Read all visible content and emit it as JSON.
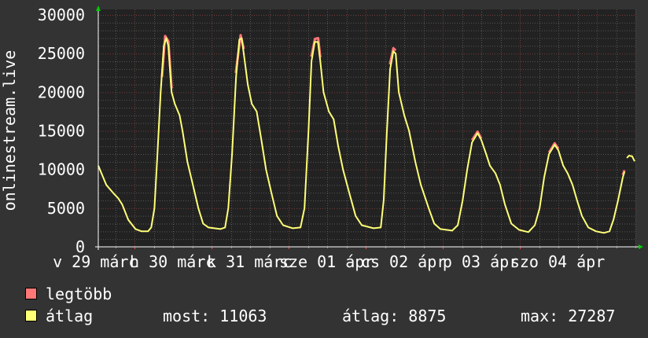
{
  "chart_data": {
    "type": "line",
    "title": "",
    "ylabel": "onlinestream.live",
    "xlabel": "",
    "ylim": [
      0,
      30000
    ],
    "xlim": [
      "03-28 12:40",
      "04-04 12:00"
    ],
    "yticks": [
      "0",
      "5000",
      "10000",
      "15000",
      "20000",
      "25000",
      "30000"
    ],
    "xticks": [
      {
        "at": "03-28 12:00",
        "label": "v 29 márc"
      },
      {
        "at": "03-29 12:00",
        "label": "h 30 márc"
      },
      {
        "at": "03-30 12:00",
        "label": "k 31 márc"
      },
      {
        "at": "03-31 12:00",
        "label": "sze 01 ápr"
      },
      {
        "at": "04-01 12:00",
        "label": "cs 02 ápr"
      },
      {
        "at": "04-02 12:00",
        "label": "p 03 ápr"
      },
      {
        "at": "04-03 12:00",
        "label": "szo 04 ápr"
      }
    ],
    "grid": true,
    "colors": {
      "background": "#333333",
      "plot": "#222222",
      "max": "#ff7777",
      "avg": "#ffff77",
      "major_grid": "#7a3a3a",
      "minor_grid": "#555555",
      "arrow": "#00cc00"
    },
    "series": [
      {
        "name": "legtöbb",
        "color": "#ff7777",
        "points": [
          [
            "03-29 08:30",
            22000
          ],
          [
            "03-29 09:30",
            27287
          ],
          [
            "03-29 10:30",
            26600
          ],
          [
            "03-29 11:30",
            20500
          ],
          null,
          [
            "03-30 07:30",
            22500
          ],
          [
            "03-30 09:00",
            27400
          ],
          [
            "03-30 10:00",
            25600
          ],
          null,
          [
            "03-31 07:00",
            24600
          ],
          [
            "03-31 08:10",
            26900
          ],
          [
            "03-31 09:10",
            27000
          ],
          [
            "03-31 09:50",
            24500
          ],
          null,
          [
            "04-01 07:30",
            23600
          ],
          [
            "04-01 08:35",
            25700
          ],
          [
            "04-01 09:20",
            25400
          ],
          null,
          [
            "04-02 09:05",
            13800
          ],
          [
            "04-02 10:50",
            14900
          ],
          [
            "04-02 12:00",
            14000
          ],
          null,
          [
            "04-03 09:05",
            12200
          ],
          [
            "04-03 10:50",
            13400
          ],
          [
            "04-03 12:00",
            12700
          ],
          null,
          [
            "04-04 08:05",
            9300
          ],
          [
            "04-04 08:35",
            9900
          ]
        ]
      },
      {
        "name": "átlag",
        "color": "#ffff77",
        "points": [
          [
            "03-28 12:40",
            10500
          ],
          [
            "03-28 15:10",
            8000
          ],
          [
            "03-28 17:40",
            6800
          ],
          [
            "03-28 18:50",
            6300
          ],
          [
            "03-28 20:05",
            5500
          ],
          [
            "03-28 22:00",
            3500
          ],
          [
            "03-29 00:15",
            2300
          ],
          [
            "03-29 02:10",
            2000
          ],
          [
            "03-29 04:10",
            2000
          ],
          [
            "03-29 05:10",
            2500
          ],
          [
            "03-29 06:10",
            5000
          ],
          [
            "03-29 07:05",
            12000
          ],
          [
            "03-29 08:05",
            20000
          ],
          [
            "03-29 09:05",
            26000
          ],
          [
            "03-29 09:50",
            27000
          ],
          [
            "03-29 10:30",
            26000
          ],
          [
            "03-29 11:30",
            20000
          ],
          [
            "03-29 12:30",
            18500
          ],
          [
            "03-29 14:00",
            17000
          ],
          [
            "03-29 14:55",
            15000
          ],
          [
            "03-29 16:25",
            11000
          ],
          [
            "03-29 18:08",
            8000
          ],
          [
            "03-29 19:50",
            5000
          ],
          [
            "03-29 21:20",
            3000
          ],
          [
            "03-29 23:00",
            2500
          ],
          [
            "03-30 02:40",
            2300
          ],
          [
            "03-30 04:10",
            2500
          ],
          [
            "03-30 05:10",
            5000
          ],
          [
            "03-30 06:20",
            12000
          ],
          [
            "03-30 07:35",
            22000
          ],
          [
            "03-30 08:35",
            26800
          ],
          [
            "03-30 09:20",
            27000
          ],
          [
            "03-30 10:00",
            25000
          ],
          [
            "03-30 11:15",
            21000
          ],
          [
            "03-30 12:30",
            18500
          ],
          [
            "03-30 14:00",
            17500
          ],
          [
            "03-30 15:25",
            14000
          ],
          [
            "03-30 16:55",
            10000
          ],
          [
            "03-30 18:35",
            7000
          ],
          [
            "03-30 20:20",
            4000
          ],
          [
            "03-30 22:15",
            2800
          ],
          [
            "03-31 01:15",
            2400
          ],
          [
            "03-31 03:40",
            2500
          ],
          [
            "03-31 04:55",
            5000
          ],
          [
            "03-31 06:10",
            15000
          ],
          [
            "03-31 07:05",
            24000
          ],
          [
            "03-31 08:05",
            26500
          ],
          [
            "03-31 09:05",
            26500
          ],
          [
            "03-31 09:50",
            24000
          ],
          [
            "03-31 10:50",
            20000
          ],
          [
            "03-31 12:30",
            17500
          ],
          [
            "03-31 14:00",
            16500
          ],
          [
            "03-31 15:25",
            13000
          ],
          [
            "03-31 16:55",
            10000
          ],
          [
            "03-31 18:50",
            7000
          ],
          [
            "03-31 20:50",
            4000
          ],
          [
            "03-31 22:45",
            2800
          ],
          [
            "04-01 02:25",
            2400
          ],
          [
            "04-01 04:40",
            2500
          ],
          [
            "04-01 05:35",
            6000
          ],
          [
            "04-01 06:35",
            15000
          ],
          [
            "04-01 07:35",
            23000
          ],
          [
            "04-01 08:35",
            25300
          ],
          [
            "04-01 09:20",
            25000
          ],
          [
            "04-01 10:17",
            20000
          ],
          [
            "04-01 12:00",
            17000
          ],
          [
            "04-01 13:30",
            15000
          ],
          [
            "04-01 15:25",
            11000
          ],
          [
            "04-01 17:10",
            8000
          ],
          [
            "04-01 19:35",
            5000
          ],
          [
            "04-01 21:20",
            3000
          ],
          [
            "04-01 23:15",
            2300
          ],
          [
            "04-02 02:55",
            2100
          ],
          [
            "04-02 04:40",
            2800
          ],
          [
            "04-02 06:10",
            6000
          ],
          [
            "04-02 07:35",
            10000
          ],
          [
            "04-02 09:05",
            13500
          ],
          [
            "04-02 10:50",
            14700
          ],
          [
            "04-02 12:00",
            13800
          ],
          [
            "04-02 13:30",
            12000
          ],
          [
            "04-02 14:40",
            10500
          ],
          [
            "04-02 16:25",
            9500
          ],
          [
            "04-02 17:50",
            8000
          ],
          [
            "04-02 19:20",
            5500
          ],
          [
            "04-02 21:20",
            3000
          ],
          [
            "04-02 23:45",
            2200
          ],
          [
            "04-03 02:40",
            1900
          ],
          [
            "04-03 04:40",
            2800
          ],
          [
            "04-03 06:10",
            5000
          ],
          [
            "04-03 07:35",
            9000
          ],
          [
            "04-03 09:05",
            12000
          ],
          [
            "04-03 10:50",
            13200
          ],
          [
            "04-03 12:00",
            12500
          ],
          [
            "04-03 13:30",
            10500
          ],
          [
            "04-03 14:55",
            9500
          ],
          [
            "04-03 16:25",
            8000
          ],
          [
            "04-03 17:50",
            6000
          ],
          [
            "04-03 19:20",
            4000
          ],
          [
            "04-03 21:20",
            2500
          ],
          [
            "04-03 23:45",
            2000
          ],
          [
            "04-04 02:10",
            1800
          ],
          [
            "04-04 03:55",
            2000
          ],
          [
            "04-04 05:10",
            3500
          ],
          [
            "04-04 06:35",
            6000
          ],
          [
            "04-04 08:05",
            9000
          ],
          [
            "04-04 08:35",
            9700
          ],
          null,
          [
            "04-04 09:20",
            11500
          ],
          [
            "04-04 10:00",
            11800
          ],
          [
            "04-04 11:00",
            11700
          ],
          [
            "04-04 11:45",
            11063
          ]
        ]
      }
    ]
  },
  "legend": {
    "max_label": "legtöbb",
    "avg_label": "átlag",
    "current": "most: 11063",
    "average": "átlag: 8875",
    "maximum": "max: 27287"
  }
}
